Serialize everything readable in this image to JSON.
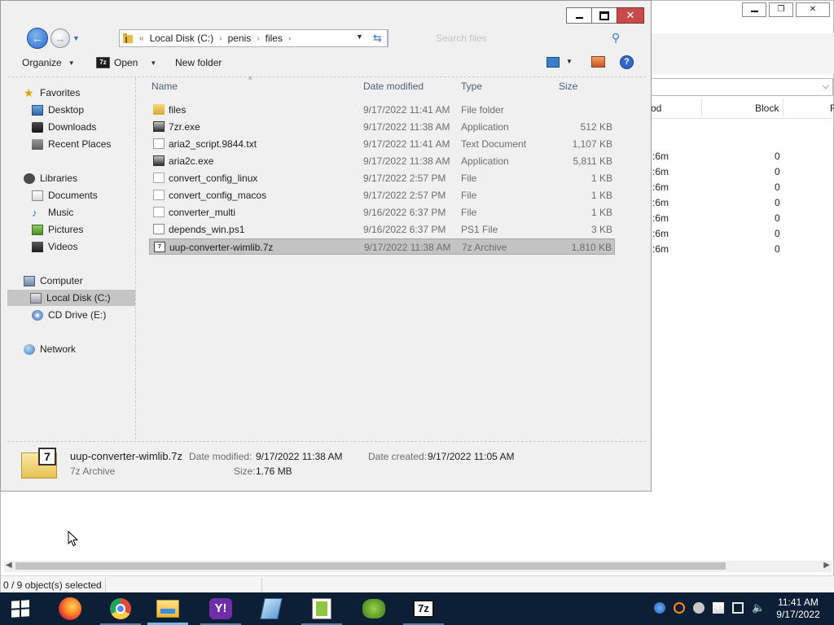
{
  "background_window": {
    "combo_arrow": "⌵",
    "headers": {
      "col_od": "od",
      "col_block": "Block",
      "col_f": "F"
    },
    "rows": [
      {
        "a": ":6m",
        "b": "0"
      },
      {
        "a": ":6m",
        "b": "0"
      },
      {
        "a": ":6m",
        "b": "0"
      },
      {
        "a": ":6m",
        "b": "0"
      },
      {
        "a": ":6m",
        "b": "0"
      },
      {
        "a": ":6m",
        "b": "0"
      },
      {
        "a": ":6m",
        "b": "0"
      }
    ],
    "status": "0 / 9 object(s) selected"
  },
  "explorer": {
    "address": {
      "overflow_chevron": "«",
      "crumbs": [
        "Local Disk (C:)",
        "penis",
        "files"
      ],
      "separator": "›"
    },
    "search_placeholder": "Search files",
    "toolbar": {
      "organize": "Organize",
      "open": "Open",
      "new_folder": "New folder",
      "help": "?"
    },
    "sidebar": {
      "favorites": "Favorites",
      "desktop": "Desktop",
      "downloads": "Downloads",
      "recent_places": "Recent Places",
      "libraries": "Libraries",
      "documents": "Documents",
      "music": "Music",
      "pictures": "Pictures",
      "videos": "Videos",
      "computer": "Computer",
      "local_disk": "Local Disk (C:)",
      "cd_drive": "CD Drive (E:)",
      "network": "Network"
    },
    "columns": {
      "name": "Name",
      "date_modified": "Date modified",
      "type": "Type",
      "size": "Size"
    },
    "files": [
      {
        "name": "files",
        "date": "9/17/2022 11:41 AM",
        "type": "File folder",
        "size": "",
        "icon": "folder-icon"
      },
      {
        "name": "7zr.exe",
        "date": "9/17/2022 11:38 AM",
        "type": "Application",
        "size": "512 KB",
        "icon": "exe-icon"
      },
      {
        "name": "aria2_script.9844.txt",
        "date": "9/17/2022 11:41 AM",
        "type": "Text Document",
        "size": "1,107 KB",
        "icon": "text-file-icon"
      },
      {
        "name": "aria2c.exe",
        "date": "9/17/2022 11:38 AM",
        "type": "Application",
        "size": "5,811 KB",
        "icon": "exe-icon"
      },
      {
        "name": "convert_config_linux",
        "date": "9/17/2022 2:57 PM",
        "type": "File",
        "size": "1 KB",
        "icon": "file-icon"
      },
      {
        "name": "convert_config_macos",
        "date": "9/17/2022 2:57 PM",
        "type": "File",
        "size": "1 KB",
        "icon": "file-icon"
      },
      {
        "name": "converter_multi",
        "date": "9/16/2022 6:37 PM",
        "type": "File",
        "size": "1 KB",
        "icon": "file-icon"
      },
      {
        "name": "depends_win.ps1",
        "date": "9/16/2022 6:37 PM",
        "type": "PS1 File",
        "size": "3 KB",
        "icon": "ps1-file-icon"
      },
      {
        "name": "uup-converter-wimlib.7z",
        "date": "9/17/2022 11:38 AM",
        "type": "7z Archive",
        "size": "1,810 KB",
        "icon": "7z-archive-icon",
        "selected": true
      }
    ],
    "details": {
      "filename": "uup-converter-wimlib.7z",
      "filetype": "7z Archive",
      "date_modified_label": "Date modified:",
      "date_modified_value": "9/17/2022 11:38 AM",
      "date_created_label": "Date created:",
      "date_created_value": "9/17/2022 11:05 AM",
      "size_label": "Size:",
      "size_value": "1.76 MB",
      "icon_glyph": "7"
    }
  },
  "taskbar": {
    "apps": [
      "firefox-icon",
      "chrome-icon",
      "file-explorer-icon",
      "yahoo-icon",
      "notepad-icon",
      "notepad-plus-plus-icon",
      "gecko-icon",
      "7zip-icon"
    ],
    "sevenzip_label": "7z",
    "yahoo_label": "Y!",
    "time": "11:41 AM",
    "date": "9/17/2022"
  },
  "colors": {
    "taskbar": "#0c1f35",
    "selection": "#c3c3c3",
    "close_button": "#c74b4b",
    "accent_blue": "#3270c6"
  }
}
